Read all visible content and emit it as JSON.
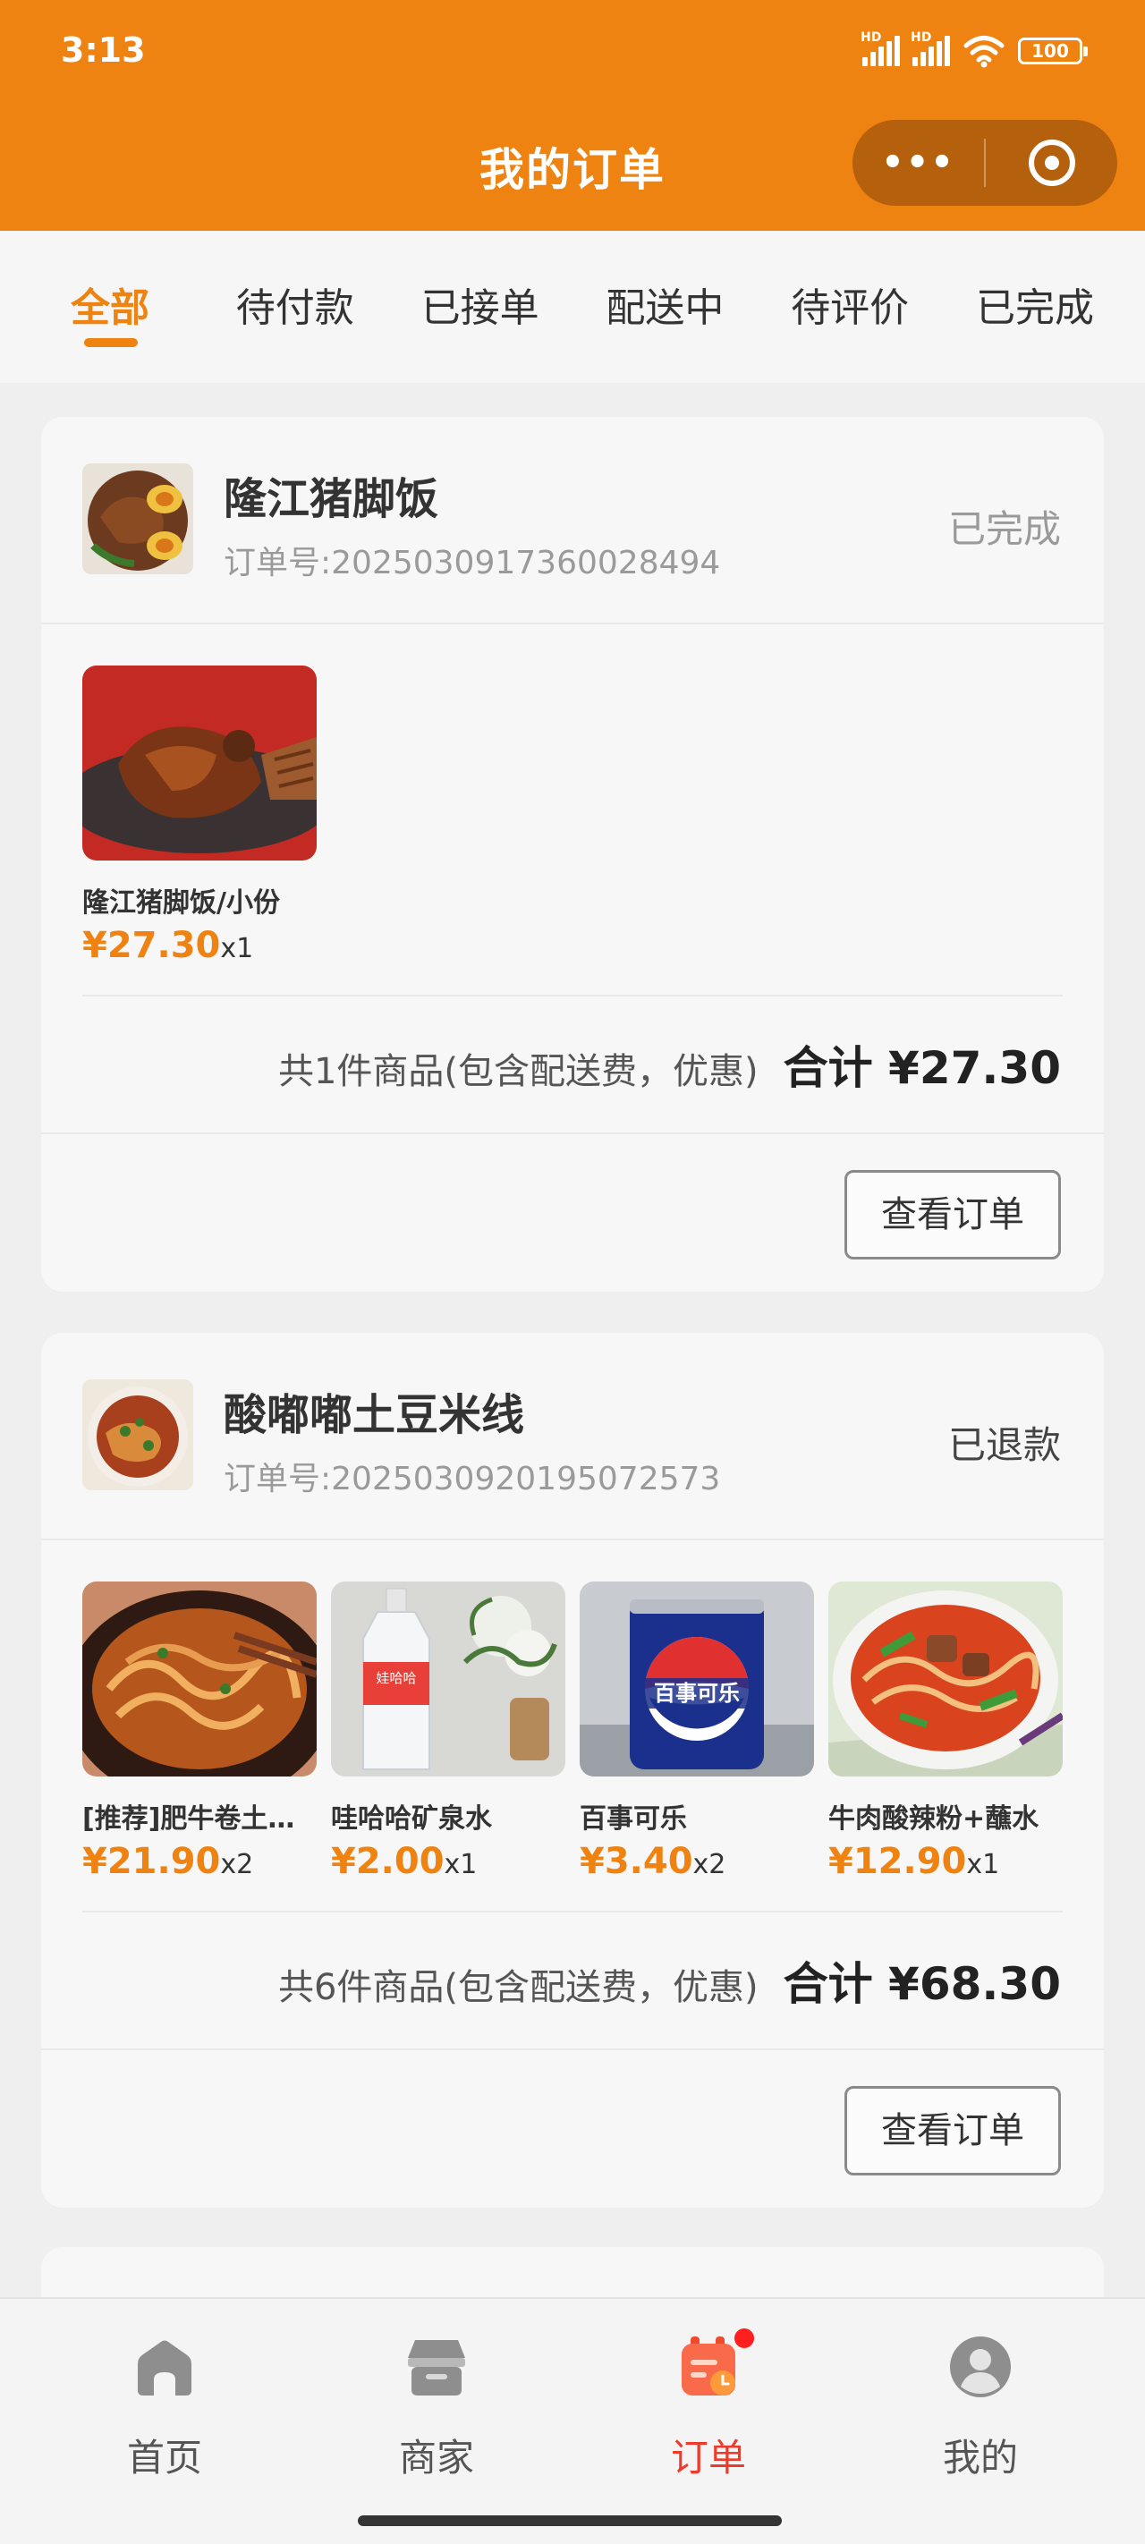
{
  "status_bar": {
    "time": "3:13",
    "signal_label": "HD",
    "battery": "100"
  },
  "header": {
    "title": "我的订单",
    "more_label": "•••"
  },
  "tabs": [
    {
      "label": "全部",
      "active": true
    },
    {
      "label": "待付款"
    },
    {
      "label": "已接单"
    },
    {
      "label": "配送中"
    },
    {
      "label": "待评价"
    },
    {
      "label": "已完成"
    }
  ],
  "orders": [
    {
      "store_name": "隆江猪脚饭",
      "order_no": "订单号:2025030917360028494",
      "status": "已完成",
      "status_color": "#9a9a9a",
      "items": [
        {
          "name": "隆江猪脚饭/小份",
          "price": "¥27.30",
          "qty": "x1"
        }
      ],
      "summary": "共1件商品(包含配送费，优惠)",
      "total": "合计 ¥27.30",
      "button": "查看订单"
    },
    {
      "store_name": "酸嘟嘟土豆米线",
      "order_no": "订单号:2025030920195072573",
      "status": "已退款",
      "status_color": "#444444",
      "items": [
        {
          "name": "[推荐]肥牛卷土…",
          "price": "¥21.90",
          "qty": "x2"
        },
        {
          "name": "哇哈哈矿泉水",
          "price": "¥2.00",
          "qty": "x1"
        },
        {
          "name": "百事可乐",
          "price": "¥3.40",
          "qty": "x2"
        },
        {
          "name": "牛肉酸辣粉+蘸水",
          "price": "¥12.90",
          "qty": "x1"
        }
      ],
      "summary": "共6件商品(包含配送费，优惠)",
      "total": "合计 ¥68.30",
      "button": "查看订单"
    }
  ],
  "nav": [
    {
      "label": "首页",
      "icon": "home-icon"
    },
    {
      "label": "商家",
      "icon": "store-icon"
    },
    {
      "label": "订单",
      "icon": "order-icon",
      "active": true,
      "badge": true
    },
    {
      "label": "我的",
      "icon": "user-icon"
    }
  ],
  "colors": {
    "accent": "#ee8311",
    "nav_active": "#ee3a2a",
    "badge": "#ff1f1f"
  },
  "image_texts": {
    "pepsi_can": "百事可乐",
    "water_label": "娃哈哈"
  }
}
